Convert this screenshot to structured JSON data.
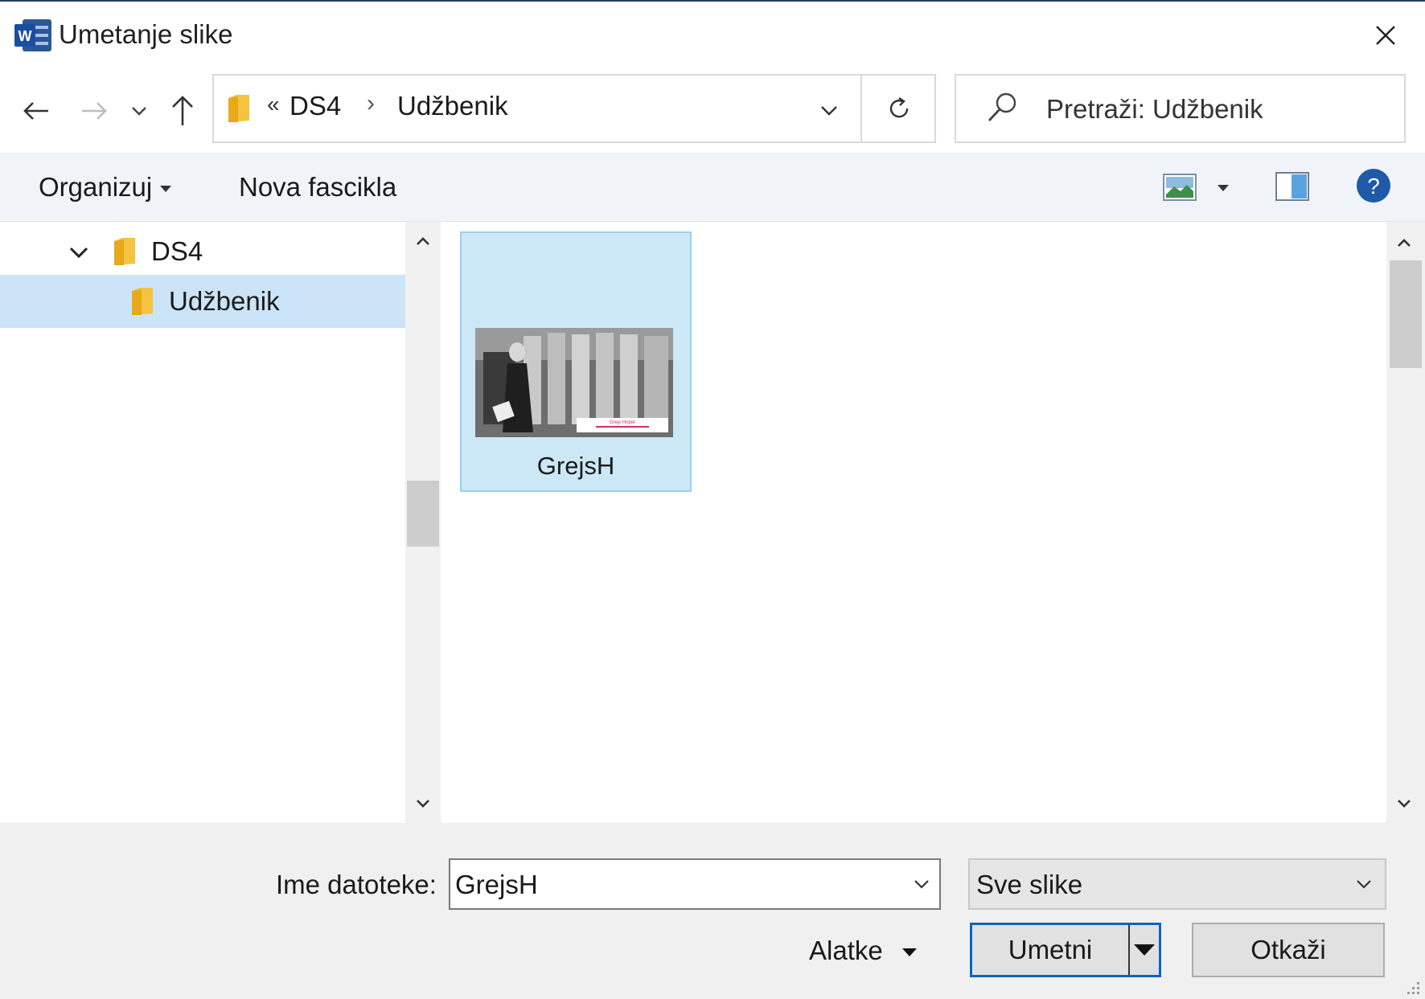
{
  "window": {
    "title": "Umetanje slike",
    "app_icon": "word-icon",
    "close_icon": "close-icon"
  },
  "navigation": {
    "back_icon": "arrow-left-icon",
    "forward_icon": "arrow-right-icon",
    "recent_icon": "chevron-down-icon",
    "up_icon": "arrow-up-icon",
    "address": {
      "overflow_marker": "«",
      "crumbs": [
        "DS4",
        "Udžbenik"
      ],
      "separator": "›"
    },
    "refresh_icon": "refresh-icon",
    "search_placeholder": "Pretraži: Udžbenik"
  },
  "toolbar": {
    "organize_label": "Organizuj",
    "new_folder_label": "Nova fascikla",
    "view_icon": "view-options-icon",
    "preview_pane_icon": "preview-pane-icon",
    "help_icon": "help-icon"
  },
  "tree": {
    "items": [
      {
        "label": "DS4",
        "expanded": true,
        "selected": false
      },
      {
        "label": "Udžbenik",
        "expanded": false,
        "selected": true
      }
    ]
  },
  "files": [
    {
      "name": "GrejsH",
      "selected": true,
      "thumb_caption": "Grejs Hoper"
    }
  ],
  "footer": {
    "filename_label": "Ime datoteke:",
    "filename_value": "GrejsH",
    "filetype_value": "Sve slike",
    "tools_label": "Alatke",
    "insert_label": "Umetni",
    "cancel_label": "Otkaži"
  },
  "colors": {
    "selection": "#cce4f7",
    "primary_border": "#0a64c2",
    "help_blue": "#1e5aa8",
    "folder_yellow": "#f5c242"
  }
}
